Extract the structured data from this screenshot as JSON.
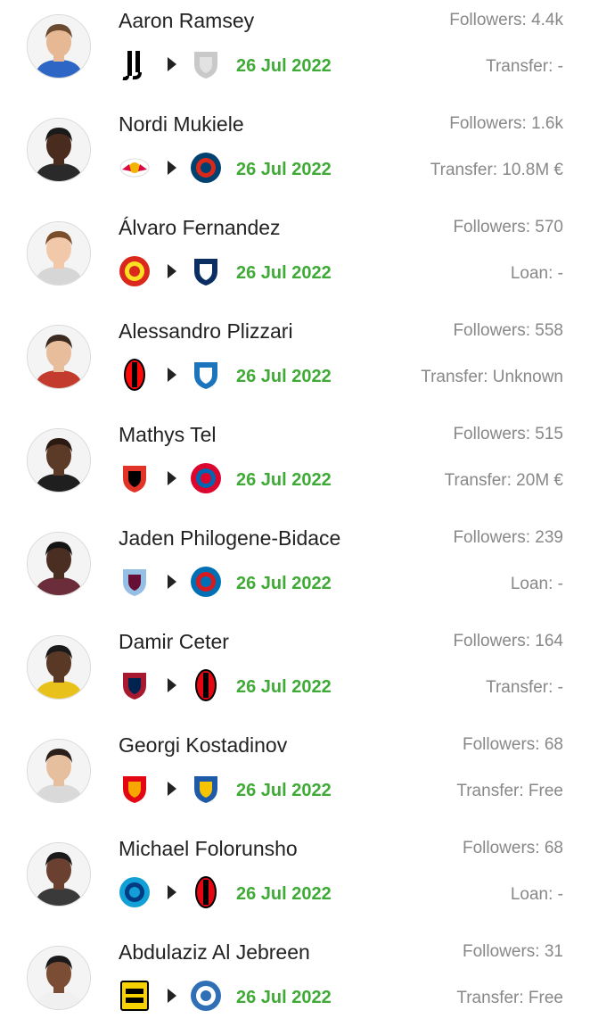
{
  "transfers": [
    {
      "name": "Aaron Ramsey",
      "followers": "Followers: 4.4k",
      "date": "26 Jul 2022",
      "fee": "Transfer: -",
      "from": {
        "icon": "juventus-logo-icon",
        "colors": [
          "#000000",
          "#ffffff"
        ]
      },
      "to": {
        "icon": "generic-club-shield-icon",
        "colors": [
          "#c9c9c9",
          "#e2e2e2"
        ]
      },
      "avatar": {
        "skin": "#e7b894",
        "hair": "#6b4a32",
        "shirt": "#2d66c4"
      }
    },
    {
      "name": "Nordi Mukiele",
      "followers": "Followers: 1.6k",
      "date": "26 Jul 2022",
      "fee": "Transfer: 10.8M €",
      "from": {
        "icon": "rb-leipzig-logo-icon",
        "colors": [
          "#dd0741",
          "#ffffff"
        ]
      },
      "to": {
        "icon": "psg-logo-icon",
        "colors": [
          "#004170",
          "#da291c"
        ]
      },
      "avatar": {
        "skin": "#4a2c1e",
        "hair": "#1a1a1a",
        "shirt": "#2a2a2a"
      }
    },
    {
      "name": "Álvaro Fernandez",
      "followers": "Followers: 570",
      "date": "26 Jul 2022",
      "fee": "Loan: -",
      "from": {
        "icon": "manchester-united-logo-icon",
        "colors": [
          "#da291c",
          "#fbe122"
        ]
      },
      "to": {
        "icon": "preston-north-end-logo-icon",
        "colors": [
          "#0a2d62",
          "#ffffff"
        ]
      },
      "avatar": {
        "skin": "#f1c8aa",
        "hair": "#7a4e2a",
        "shirt": "#d6d6d6"
      }
    },
    {
      "name": "Alessandro Plizzari",
      "followers": "Followers: 558",
      "date": "26 Jul 2022",
      "fee": "Transfer: Unknown",
      "from": {
        "icon": "ac-milan-logo-icon",
        "colors": [
          "#fb090b",
          "#000000"
        ]
      },
      "to": {
        "icon": "pescara-logo-icon",
        "colors": [
          "#1c75bc",
          "#ffffff"
        ]
      },
      "avatar": {
        "skin": "#e8bd9c",
        "hair": "#3a2a20",
        "shirt": "#c33b2d"
      }
    },
    {
      "name": "Mathys Tel",
      "followers": "Followers: 515",
      "date": "26 Jul 2022",
      "fee": "Transfer: 20M €",
      "from": {
        "icon": "stade-rennais-logo-icon",
        "colors": [
          "#e13327",
          "#000000"
        ]
      },
      "to": {
        "icon": "bayern-munich-logo-icon",
        "colors": [
          "#dc052d",
          "#0066b2"
        ]
      },
      "avatar": {
        "skin": "#5c3a28",
        "hair": "#2a1a12",
        "shirt": "#1f1f1f"
      }
    },
    {
      "name": "Jaden Philogene-Bidace",
      "followers": "Followers: 239",
      "date": "26 Jul 2022",
      "fee": "Loan: -",
      "from": {
        "icon": "aston-villa-logo-icon",
        "colors": [
          "#95bfe5",
          "#670e36"
        ]
      },
      "to": {
        "icon": "cardiff-city-logo-icon",
        "colors": [
          "#0070b5",
          "#d71920"
        ]
      },
      "avatar": {
        "skin": "#4b2e22",
        "hair": "#141414",
        "shirt": "#6b2d3a"
      }
    },
    {
      "name": "Damir Ceter",
      "followers": "Followers: 164",
      "date": "26 Jul 2022",
      "fee": "Transfer: -",
      "from": {
        "icon": "cagliari-logo-icon",
        "colors": [
          "#a6192e",
          "#002350"
        ]
      },
      "to": {
        "icon": "bari-logo-icon",
        "colors": [
          "#e30613",
          "#000000"
        ]
      },
      "avatar": {
        "skin": "#5a3826",
        "hair": "#1a1a1a",
        "shirt": "#e8c21a"
      }
    },
    {
      "name": "Georgi Kostadinov",
      "followers": "Followers: 68",
      "date": "26 Jul 2022",
      "fee": "Transfer: Free",
      "from": {
        "icon": "arsenal-tula-logo-icon",
        "colors": [
          "#e30613",
          "#f6a800"
        ]
      },
      "to": {
        "icon": "apoel-logo-icon",
        "colors": [
          "#1e5aa8",
          "#f6c400"
        ]
      },
      "avatar": {
        "skin": "#e6bf9f",
        "hair": "#2a1f18",
        "shirt": "#d9d9d9"
      }
    },
    {
      "name": "Michael Folorunsho",
      "followers": "Followers: 68",
      "date": "26 Jul 2022",
      "fee": "Loan: -",
      "from": {
        "icon": "napoli-logo-icon",
        "colors": [
          "#12a0d7",
          "#003c82"
        ]
      },
      "to": {
        "icon": "bari-logo-icon",
        "colors": [
          "#e30613",
          "#000000"
        ]
      },
      "avatar": {
        "skin": "#6a4030",
        "hair": "#1a1a1a",
        "shirt": "#3a3a3a"
      }
    },
    {
      "name": "Abdulaziz Al Jebreen",
      "followers": "Followers: 31",
      "date": "26 Jul 2022",
      "fee": "Transfer: Free",
      "from": {
        "icon": "al-ittihad-logo-icon",
        "colors": [
          "#f7d100",
          "#000000"
        ]
      },
      "to": {
        "icon": "al-fateh-logo-icon",
        "colors": [
          "#2e6fb6",
          "#ffffff"
        ]
      },
      "avatar": {
        "skin": "#7a4d34",
        "hair": "#1a1a1a",
        "shirt": "#f0f0f0"
      }
    }
  ]
}
